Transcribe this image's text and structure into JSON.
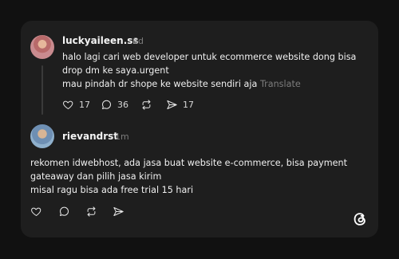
{
  "post": {
    "username": "luckyaileen.ss",
    "time": "6d",
    "lines": [
      "halo lagi cari web developer untuk ecommerce website dong bisa",
      "drop dm ke saya.urgent",
      "mau pindah dr shope ke website sendiri aja"
    ],
    "translate": "Translate",
    "likes": "17",
    "replies": "36",
    "shares": "17"
  },
  "reply": {
    "username": "rievandrst",
    "time": "1m",
    "lines": [
      "rekomen idwebhost, ada jasa buat website e-commerce, bisa payment",
      "gateaway dan pilih jasa kirim",
      "misal ragu bisa ada free trial 15 hari"
    ]
  },
  "icons": {
    "like": "heart-icon",
    "reply": "comment-icon",
    "repost": "repost-icon",
    "share": "send-icon",
    "logo": "threads-logo-icon"
  },
  "colors": {
    "background": "#111111",
    "card": "#1e1e1e",
    "text": "#f0f0f0",
    "muted": "#7c7c7c"
  }
}
